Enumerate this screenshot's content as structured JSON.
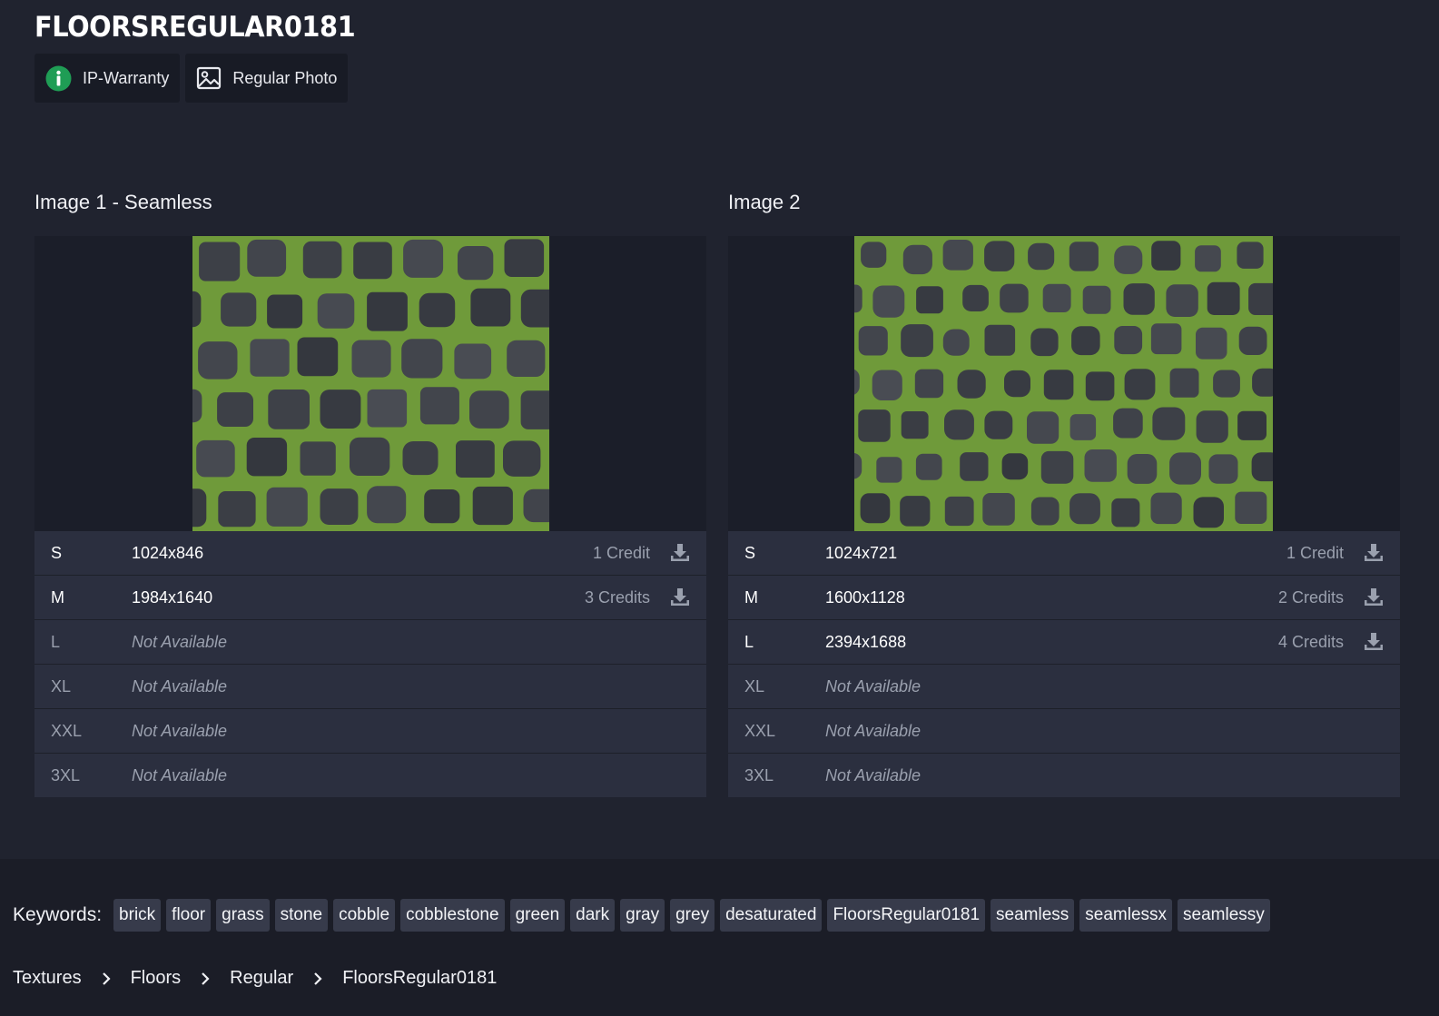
{
  "title": "FLOORSREGULAR0181",
  "badges": [
    {
      "label": "IP-Warranty",
      "icon": "info-icon",
      "color": "#1f9d55"
    },
    {
      "label": "Regular Photo",
      "icon": "image-icon"
    }
  ],
  "images": [
    {
      "title": "Image 1 - Seamless",
      "sizes": [
        {
          "size": "S",
          "resolution": "1024x846",
          "credits": "1 Credit",
          "available": true
        },
        {
          "size": "M",
          "resolution": "1984x1640",
          "credits": "3 Credits",
          "available": true
        },
        {
          "size": "L",
          "resolution": "Not Available",
          "credits": "",
          "available": false
        },
        {
          "size": "XL",
          "resolution": "Not Available",
          "credits": "",
          "available": false
        },
        {
          "size": "XXL",
          "resolution": "Not Available",
          "credits": "",
          "available": false
        },
        {
          "size": "3XL",
          "resolution": "Not Available",
          "credits": "",
          "available": false
        }
      ]
    },
    {
      "title": "Image 2",
      "sizes": [
        {
          "size": "S",
          "resolution": "1024x721",
          "credits": "1 Credit",
          "available": true
        },
        {
          "size": "M",
          "resolution": "1600x1128",
          "credits": "2 Credits",
          "available": true
        },
        {
          "size": "L",
          "resolution": "2394x1688",
          "credits": "4 Credits",
          "available": true
        },
        {
          "size": "XL",
          "resolution": "Not Available",
          "credits": "",
          "available": false
        },
        {
          "size": "XXL",
          "resolution": "Not Available",
          "credits": "",
          "available": false
        },
        {
          "size": "3XL",
          "resolution": "Not Available",
          "credits": "",
          "available": false
        }
      ]
    }
  ],
  "keywords_label": "Keywords:",
  "keywords": [
    "brick",
    "floor",
    "grass",
    "stone",
    "cobble",
    "cobblestone",
    "green",
    "dark",
    "gray",
    "grey",
    "desaturated",
    "FloorsRegular0181",
    "seamless",
    "seamlessx",
    "seamlessy"
  ],
  "breadcrumb": [
    "Textures",
    "Floors",
    "Regular",
    "FloorsRegular0181"
  ],
  "colors": {
    "background": "#20232f",
    "table_row": "#2b2f3f",
    "keyword_bg": "#373b4b",
    "grass": "#6f9a3a",
    "stone": "#3c3f48"
  }
}
